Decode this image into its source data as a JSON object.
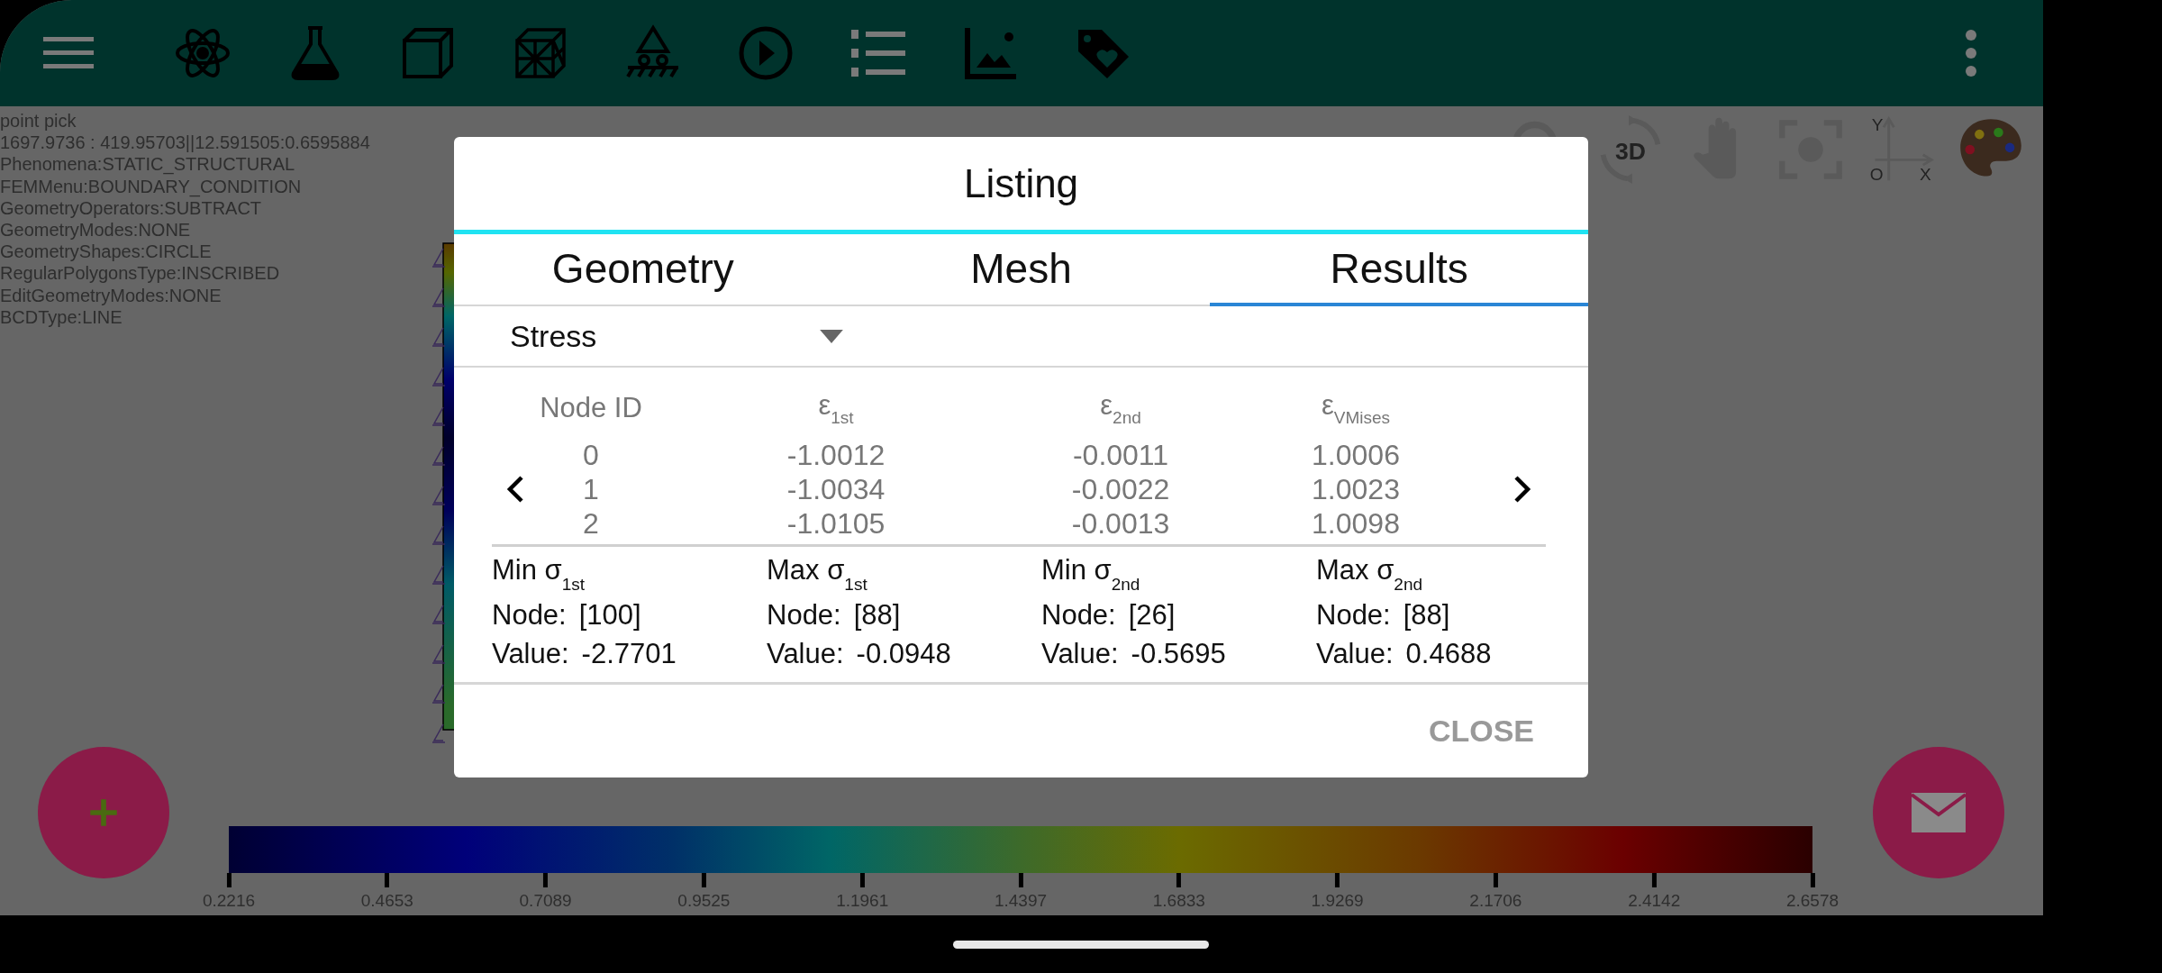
{
  "info_lines": [
    "point pick",
    "1697.9736 : 419.95703||12.591505:0.6595884",
    "Phenomena:STATIC_STRUCTURAL",
    "FEMMenu:BOUNDARY_CONDITION",
    "GeometryOperators:SUBTRACT",
    "GeometryModes:NONE",
    "GeometryShapes:CIRCLE",
    "RegularPolygonsType:INSCRIBED",
    "EditGeometryModes:NONE",
    "BCDType:LINE"
  ],
  "view_tools": {
    "rotate_label": "3D",
    "axis_y": "Y",
    "axis_x": "X",
    "axis_origin": "O"
  },
  "dialog": {
    "title": "Listing",
    "tabs": [
      {
        "label": "Geometry",
        "selected": false
      },
      {
        "label": "Mesh",
        "selected": false
      },
      {
        "label": "Results",
        "selected": true
      }
    ],
    "dropdown": {
      "value": "Stress"
    },
    "table": {
      "columns": [
        "Node ID",
        "ε$_{1st}$",
        "ε$_{2nd}$",
        "ε$_{VMises}$"
      ],
      "rows": [
        [
          "0",
          "-1.0012",
          "-0.0011",
          "1.0006"
        ],
        [
          "1",
          "-1.0034",
          "-0.0022",
          "1.0023"
        ],
        [
          "2",
          "-1.0105",
          "-0.0013",
          "1.0098"
        ]
      ]
    },
    "summary": [
      {
        "title": "Min σ$_{1st}$",
        "node_label": "Node:",
        "node": "[100]",
        "value_label": "Value:",
        "value": "-2.7701"
      },
      {
        "title": "Max σ$_{1st}$",
        "node_label": "Node:",
        "node": "[88]",
        "value_label": "Value:",
        "value": "-0.0948"
      },
      {
        "title": "Min σ$_{2nd}$",
        "node_label": "Node:",
        "node": "[26]",
        "value_label": "Value:",
        "value": "-0.5695"
      },
      {
        "title": "Max σ$_{2nd}$",
        "node_label": "Node:",
        "node": "[88]",
        "value_label": "Value:",
        "value": "0.4688"
      }
    ],
    "close_button": "CLOSE"
  },
  "colorbar": {
    "ticks": [
      "0.2216",
      "0.4653",
      "0.7089",
      "0.9525",
      "1.1961",
      "1.4397",
      "1.6833",
      "1.9269",
      "2.1706",
      "2.4142",
      "2.6578"
    ]
  }
}
